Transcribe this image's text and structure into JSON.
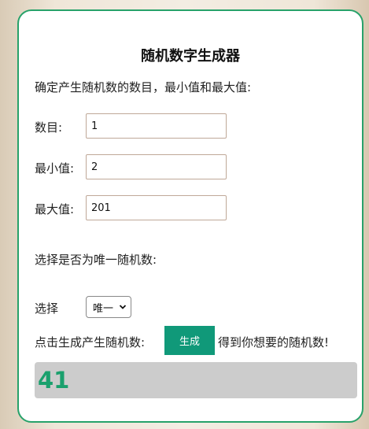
{
  "form": {
    "title": "随机数字生成器",
    "description": "确定产生随机数的数目，最小值和最大值:",
    "count_label": "数目:",
    "count_value": "1",
    "min_label": "最小值:",
    "min_value": "2",
    "max_label": "最大值:",
    "max_value": "201",
    "unique_question": "选择是否为唯一随机数:",
    "select_label": "选择",
    "select_value": "唯一",
    "generate_hint": "点击生成产生随机数:",
    "generate_button": "生成",
    "generate_suffix": "得到你想要的随机数!",
    "result": "41"
  },
  "colors": {
    "accent": "#109979",
    "card_border": "#27a26a",
    "result_text": "#1aa06d",
    "result_bg": "#cccccc"
  },
  "icons": {
    "select_chevron": "chevron-down-icon"
  }
}
